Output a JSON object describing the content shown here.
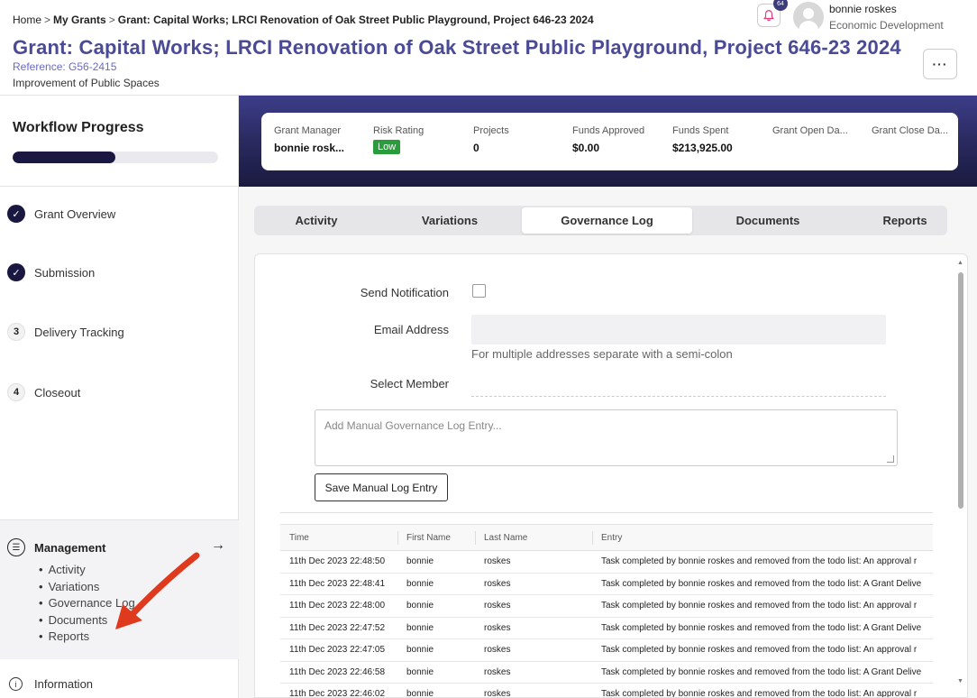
{
  "breadcrumb": {
    "home": "Home",
    "sep": ">",
    "my_grants": "My Grants",
    "current": "Grant: Capital Works; LRCI Renovation of Oak Street Public Playground, Project 646-23 2024"
  },
  "page": {
    "title": "Grant: Capital Works; LRCI Renovation of Oak Street Public Playground, Project 646-23 2024",
    "reference": "Reference: G56-2415",
    "subtitle": "Improvement of Public Spaces",
    "more_label": "···"
  },
  "user": {
    "name": "bonnie roskes",
    "department": "Economic Development",
    "notification_count": "64"
  },
  "sidebar": {
    "workflow_title": "Workflow Progress",
    "progress": 0.5,
    "steps": [
      {
        "icon": "✓",
        "label": "Grant Overview"
      },
      {
        "icon": "✓",
        "label": "Submission"
      },
      {
        "icon": "3",
        "label": "Delivery Tracking"
      },
      {
        "icon": "4",
        "label": "Closeout"
      }
    ],
    "management": {
      "label": "Management",
      "arrow": "→",
      "items": [
        "Activity",
        "Variations",
        "Governance Log",
        "Documents",
        "Reports"
      ]
    },
    "information_label": "Information"
  },
  "stats": [
    {
      "label": "Grant Manager",
      "value": "bonnie rosk..."
    },
    {
      "label": "Risk Rating",
      "value": "Low"
    },
    {
      "label": "Projects",
      "value": "0"
    },
    {
      "label": "Funds Approved",
      "value": "$0.00"
    },
    {
      "label": "Funds Spent",
      "value": "$213,925.00"
    },
    {
      "label": "Grant Open Da...",
      "value": ""
    },
    {
      "label": "Grant Close Da...",
      "value": ""
    }
  ],
  "tabs": [
    "Activity",
    "Variations",
    "Governance Log",
    "Documents",
    "Reports"
  ],
  "active_tab": "Governance Log",
  "form": {
    "send_notification_label": "Send Notification",
    "email_label": "Email Address",
    "email_value": "",
    "email_hint": "For multiple addresses separate with a semi-colon",
    "select_member_label": "Select Member",
    "log_placeholder": "Add Manual Governance Log Entry...",
    "save_label": "Save Manual Log Entry"
  },
  "log_table": {
    "columns": [
      "Time",
      "First Name",
      "Last Name",
      "Entry"
    ],
    "rows": [
      [
        "11th Dec 2023 22:48:50",
        "bonnie",
        "roskes",
        "Task completed by bonnie roskes and removed from the todo list: An approval r"
      ],
      [
        "11th Dec 2023 22:48:41",
        "bonnie",
        "roskes",
        "Task completed by bonnie roskes and removed from the todo list: A Grant Delive"
      ],
      [
        "11th Dec 2023 22:48:00",
        "bonnie",
        "roskes",
        "Task completed by bonnie roskes and removed from the todo list: An approval r"
      ],
      [
        "11th Dec 2023 22:47:52",
        "bonnie",
        "roskes",
        "Task completed by bonnie roskes and removed from the todo list: A Grant Delive"
      ],
      [
        "11th Dec 2023 22:47:05",
        "bonnie",
        "roskes",
        "Task completed by bonnie roskes and removed from the todo list: An approval r"
      ],
      [
        "11th Dec 2023 22:46:58",
        "bonnie",
        "roskes",
        "Task completed by bonnie roskes and removed from the todo list: A Grant Delive"
      ],
      [
        "11th Dec 2023 22:46:02",
        "bonnie",
        "roskes",
        "Task completed by bonnie roskes and removed from the todo list: An approval r"
      ]
    ]
  },
  "colors": {
    "accent": "#4b4a96",
    "hero": "#2a2a60",
    "risk_low": "#2b9c3b",
    "annotation_arrow": "#e03a1e"
  }
}
